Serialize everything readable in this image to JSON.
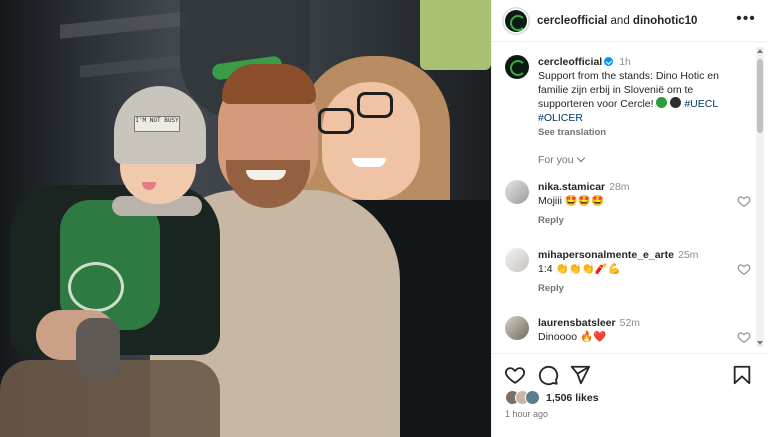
{
  "header": {
    "account": "cercleofficial",
    "joiner": "and",
    "collaborator": "dinohotic10",
    "more_icon": "more-horizontal-icon"
  },
  "caption": {
    "user": "cercleofficial",
    "time": "1h",
    "text": "Support from the stands: Dino Hotic en familie zijn erbij in Slovenië om te supporteren voor Cercle!",
    "emoji_green": "green-circle",
    "emoji_black": "black-circle",
    "hashtag1": "#UECL",
    "hashtag2": "#OLICER",
    "see_translation": "See translation"
  },
  "filter": {
    "label": "For you"
  },
  "comments": [
    {
      "user": "nika.stamicar",
      "time": "28m",
      "text": "Mojiii 🤩🤩🤩",
      "reply": "Reply"
    },
    {
      "user": "mihapersonalmente_e_arte",
      "time": "25m",
      "text": "1:4 👏👏👏🧨💪",
      "reply": "Reply"
    },
    {
      "user": "laurensbatsleer",
      "time": "52m",
      "text": "Dinoooo 🔥❤️",
      "reply": ""
    }
  ],
  "actions": {
    "like_icon": "heart-icon",
    "comment_icon": "comment-icon",
    "share_icon": "send-icon",
    "save_icon": "bookmark-icon"
  },
  "likes": "1,506 likes",
  "posted": "1 hour ago",
  "photo": {
    "hat_text": "I'M NOT BUSY",
    "description_colors": {
      "jersey": "#2f7a43",
      "brand_green": "#3aa849"
    }
  },
  "colors": {
    "link": "#00376b",
    "verified": "#0095f6",
    "muted": "#737373"
  }
}
